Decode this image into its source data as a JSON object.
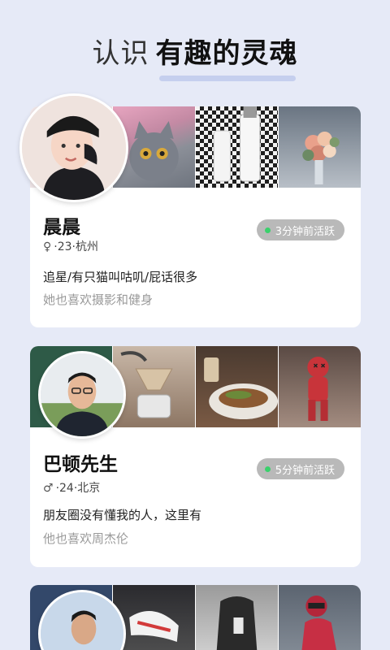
{
  "header": {
    "title_light": "认识",
    "title_bold": "有趣的灵魂"
  },
  "colors": {
    "background": "#e6eaf7",
    "card": "#ffffff",
    "status_badge": "#b9b9b9",
    "online_dot": "#3ad16c"
  },
  "cards": [
    {
      "name": "晨晨",
      "gender_icon": "female-icon",
      "gender_symbol": "♀",
      "meta": "·23·杭州",
      "status": "3分钟前活跃",
      "motto": "追星/有只猫叫咕叽/屁话很多",
      "hobby": "她也喜欢摄影和健身"
    },
    {
      "name": "巴顿先生",
      "gender_icon": "male-icon",
      "gender_symbol": "♂",
      "meta": "·24·北京",
      "status": "5分钟前活跃",
      "motto": "朋友圈没有懂我的人，这里有",
      "hobby": "他也喜欢周杰伦"
    }
  ]
}
